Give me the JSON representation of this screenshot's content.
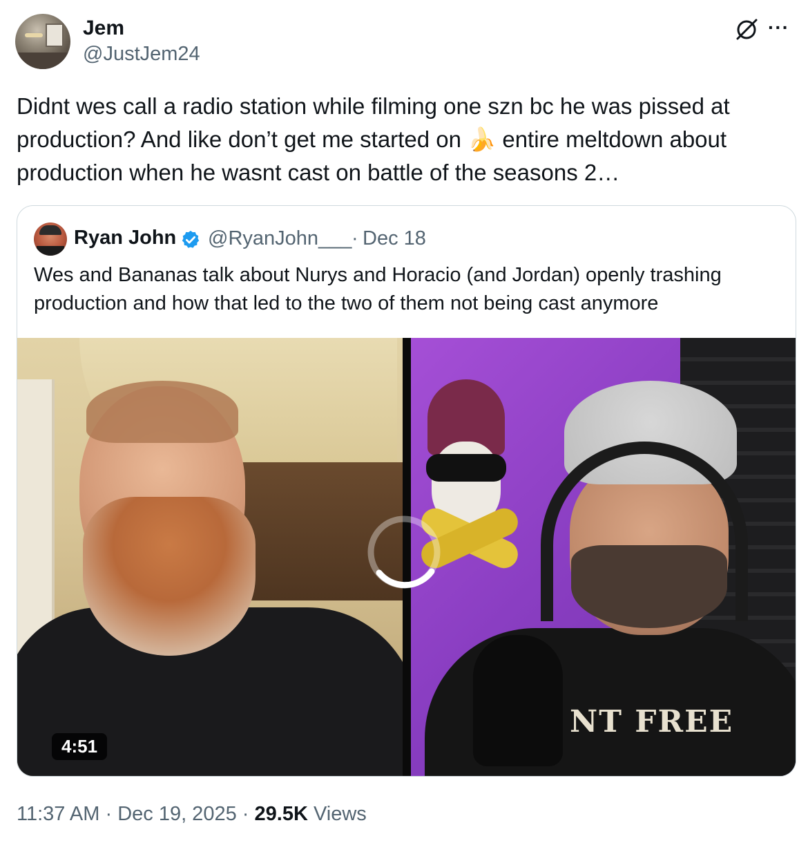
{
  "author": {
    "name": "Jem",
    "handle": "@JustJem24"
  },
  "tweet": {
    "text_part1": "Didnt wes call a radio station while filming one szn bc he was pissed at production? And like don’t get me started on ",
    "emoji": "🍌",
    "text_part2": " entire meltdown about production when he wasnt cast on battle of the seasons 2…"
  },
  "quote": {
    "name": "Ryan John",
    "handle": "@RyanJohn___",
    "separator": "·",
    "date": "Dec 18",
    "text": "Wes and Bananas talk about Nurys and Horacio (and Jordan) openly trashing production and how that led to the two of them not being cast anymore",
    "video_duration": "4:51",
    "shirt_text": "NT FREE"
  },
  "meta": {
    "time": "11:37 AM",
    "sep1": "·",
    "date": "Dec 19, 2025",
    "sep2": "·",
    "views_count": "29.5K",
    "views_label": "Views"
  },
  "icons": {
    "grok": "grok-icon",
    "more": "more-icon",
    "verified": "verified-badge-icon"
  },
  "colors": {
    "verified": "#1d9bf0",
    "secondary_text": "#536471",
    "border": "#cfd9de"
  }
}
